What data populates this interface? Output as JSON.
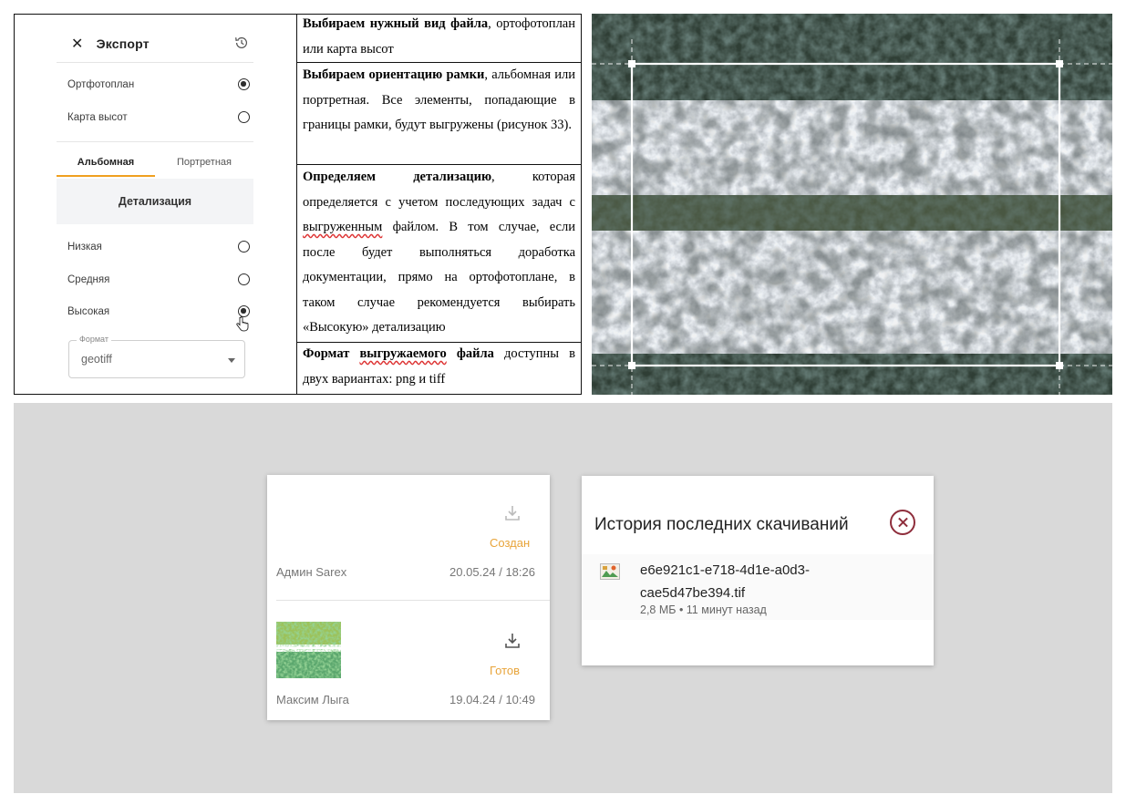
{
  "export_panel": {
    "title": "Экспорт",
    "close_glyph": "✕",
    "history_icon": "history-icon",
    "file_types": [
      {
        "label": "Ортфотоплан",
        "selected": true
      },
      {
        "label": "Карта высот",
        "selected": false
      }
    ],
    "tabs": [
      {
        "label": "Альбомная",
        "active": true
      },
      {
        "label": "Портретная",
        "active": false
      }
    ],
    "detail_heading": "Детализация",
    "detail_levels": [
      {
        "label": "Низкая",
        "selected": false
      },
      {
        "label": "Средняя",
        "selected": false
      },
      {
        "label": "Высокая",
        "selected": true
      }
    ],
    "format": {
      "label": "Формат",
      "value": "geotiff"
    },
    "accent_color": "#f0a020"
  },
  "doc_table": {
    "row1_bold": "Выбираем нужный вид файла",
    "row1_rest": ", ортофотоплан или карта высот",
    "row2_bold": "Выбираем ориентацию рамки",
    "row2_rest": ", альбомная или портретная. Все элементы, попадающие в границы рамки, будут выгружены (рисунок 33).",
    "row3_bold": "Определяем детализацию",
    "row3_a": ", которая определяется с учетом последующих задач с ",
    "row3_ul": "выгруженным",
    "row3_b": " файлом. В том случае, если после будет выполняться доработка документации, прямо на ортофотоплане, в таком случае рекомендуется выбирать «Высокую» детализацию",
    "row4_bold_a": "Формат ",
    "row4_ul": "выгружаемого",
    "row4_bold_b": " файла",
    "row4_rest": " доступны в двух вариантах: png и tiff"
  },
  "exports_list": {
    "items": [
      {
        "status": "Создан",
        "author": "Админ Sarex",
        "datetime": "20.05.24 / 18:26",
        "has_thumbnail": false
      },
      {
        "status": "Готов",
        "author": "Максим Лыга",
        "datetime": "19.04.24 / 10:49",
        "has_thumbnail": true
      }
    ],
    "status_color": "#e8a43a"
  },
  "download_history": {
    "title": "История последних скачиваний",
    "file_name": "e6e921c1-e718-4d1e-a0d3-cae5d47be394.tif",
    "file_meta": "2,8 МБ • 11 минут назад",
    "close_color": "#8e2d3b"
  }
}
